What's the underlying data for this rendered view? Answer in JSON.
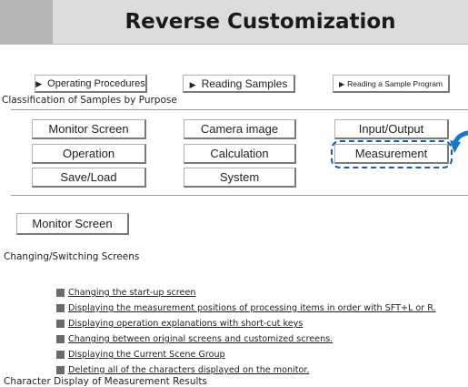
{
  "header": {
    "title": "Reverse Customization"
  },
  "nav": {
    "operating_procedures": "Operating Procedures",
    "reading_samples": "Reading Samples",
    "reading_sample_program": "Reading a Sample Program"
  },
  "classification_label": "Classification of Samples by Purpose",
  "categories": [
    "Monitor Screen",
    "Camera image",
    "Input/Output",
    "Operation",
    "Calculation",
    "Measurement",
    "Save/Load",
    "System"
  ],
  "section": {
    "button": "Monitor Screen",
    "heading": "Changing/Switching Screens",
    "links": [
      "Changing the start-up screen",
      "Displaying the measurement positions of processing items in order with SFT+L or R.",
      "Displaying operation explanations with short-cut keys",
      "Changing between original screens and customized screens.",
      "Displaying the Current Scene Group",
      "Deleting all of the characters displayed on the monitor."
    ],
    "next_heading": "Character Display of Measurement Results"
  },
  "colors": {
    "highlight": "#1a5cb0",
    "arrow": "#1279c8"
  }
}
